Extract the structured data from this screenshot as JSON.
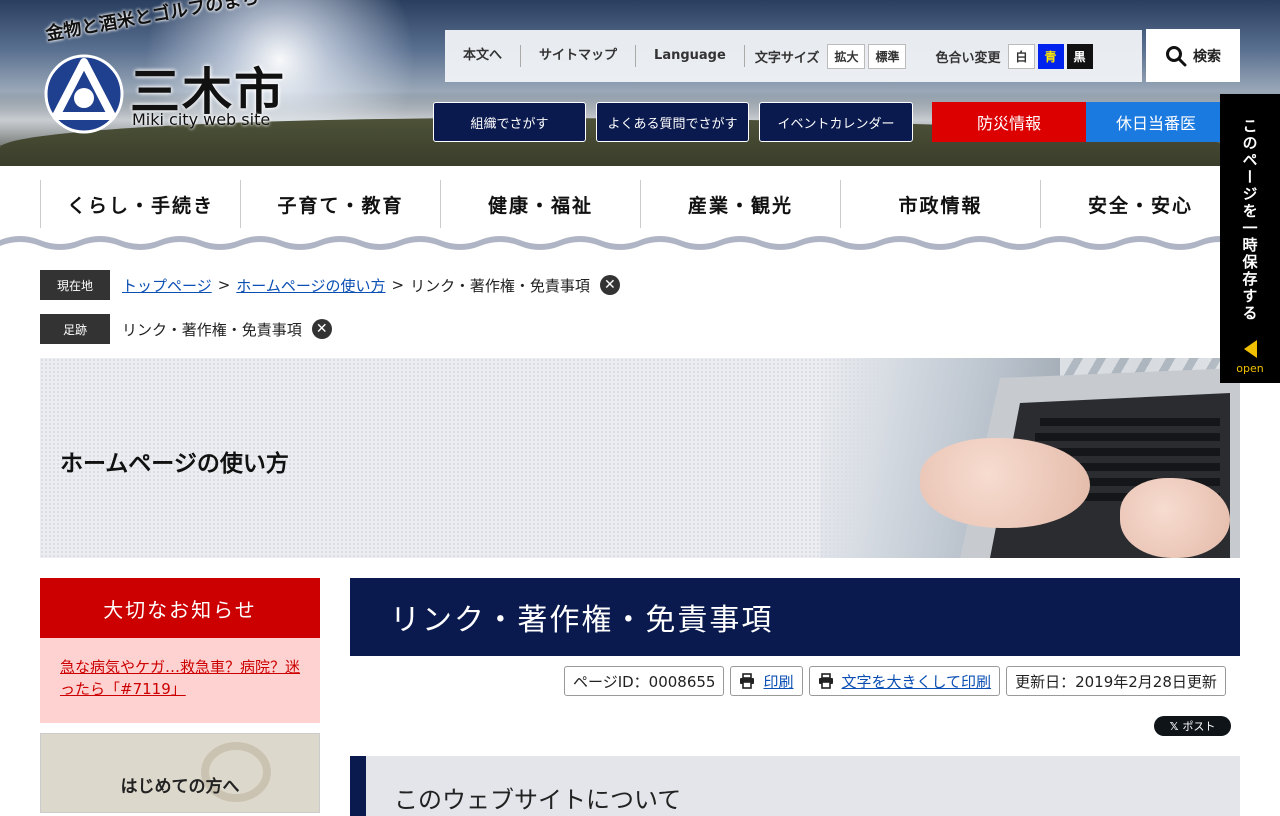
{
  "header": {
    "tagline": "金物と酒米とゴルフのまち",
    "city_name": "三木市",
    "site_sub": "Miki city web site",
    "toolbar": {
      "skip": "本文へ",
      "sitemap": "サイトマップ",
      "language": "Language",
      "font_size_label": "文字サイズ",
      "font_large": "拡大",
      "font_normal": "標準",
      "color_label": "色合い変更",
      "color_white": "白",
      "color_blue": "青",
      "color_black": "黒"
    },
    "search_label": "検索",
    "nav_buttons": [
      "組織でさがす",
      "よくある質問でさがす",
      "イベントカレンダー"
    ],
    "bousai": "防災情報",
    "kyujitsu": "休日当番医",
    "side_save": "このページを一時保存する",
    "side_open": "open"
  },
  "gnav": [
    "くらし・手続き",
    "子育て・教育",
    "健康・福祉",
    "産業・観光",
    "市政情報",
    "安全・安心"
  ],
  "breadcrumb": {
    "label": "現在地",
    "links": [
      "トップページ",
      "ホームページの使い方"
    ],
    "current": "リンク・著作権・免責事項",
    "sep": ">"
  },
  "footprint": {
    "label": "足跡",
    "item": "リンク・著作権・免責事項"
  },
  "hero": {
    "title": "ホームページの使い方"
  },
  "sidebar": {
    "notice_title": "大切なお知らせ",
    "notice_link": "急な病気やケガ…救急車？病院？迷ったら「#7119」",
    "first_visit": "はじめての方へ"
  },
  "main": {
    "title": "リンク・著作権・免責事項",
    "page_id": "ページID：0008655",
    "print": "印刷",
    "print_large": "文字を大きくして印刷",
    "updated": "更新日：2019年2月28日更新",
    "x_post": "ポスト",
    "section_title": "このウェブサイトについて"
  },
  "colors": {
    "navy": "#0a1a4e",
    "red": "#cc0000",
    "blue": "#1a7ae0",
    "notice_bg": "#ffd2d2"
  }
}
